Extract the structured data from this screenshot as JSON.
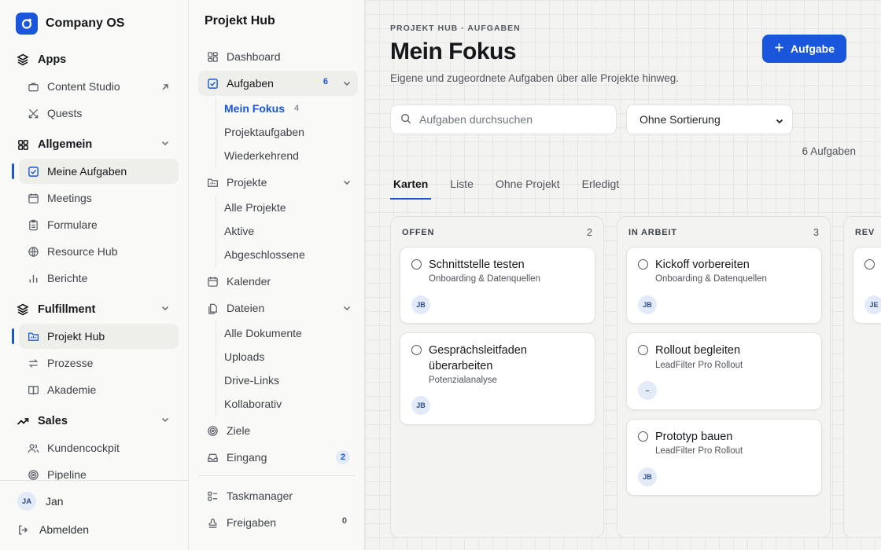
{
  "app": {
    "name": "Company OS"
  },
  "sidebar": {
    "sections": [
      {
        "label": "Apps",
        "icon": "apps-icon"
      },
      {
        "label": "Allgemein",
        "icon": "grid-icon"
      },
      {
        "label": "Fulfillment",
        "icon": "layers-icon"
      },
      {
        "label": "Sales",
        "icon": "trending-icon"
      }
    ],
    "items": [
      {
        "label": "Content Studio",
        "icon": "briefcase-icon"
      },
      {
        "label": "Quests",
        "icon": "swords-icon"
      },
      {
        "label": "Meine Aufgaben",
        "icon": "check-square-icon"
      },
      {
        "label": "Meetings",
        "icon": "calendar-icon"
      },
      {
        "label": "Formulare",
        "icon": "clipboard-icon"
      },
      {
        "label": "Resource Hub",
        "icon": "globe-icon"
      },
      {
        "label": "Berichte",
        "icon": "bar-chart-icon"
      },
      {
        "label": "Projekt Hub",
        "icon": "folder-icon"
      },
      {
        "label": "Prozesse",
        "icon": "arrows-icon"
      },
      {
        "label": "Akademie",
        "icon": "book-icon"
      },
      {
        "label": "Kundencockpit",
        "icon": "users-icon"
      },
      {
        "label": "Pipeline",
        "icon": "target-icon"
      }
    ],
    "user": {
      "initials": "JA",
      "name": "Jan"
    },
    "logout": "Abmelden"
  },
  "project_nav": {
    "title": "Projekt Hub",
    "items": [
      {
        "label": "Dashboard"
      },
      {
        "label": "Aufgaben",
        "badge": "6"
      },
      {
        "label": "Projekte"
      },
      {
        "label": "Kalender"
      },
      {
        "label": "Dateien"
      },
      {
        "label": "Ziele"
      },
      {
        "label": "Eingang",
        "badge": "2"
      },
      {
        "label": "Taskmanager"
      },
      {
        "label": "Freigaben",
        "badge": "0"
      }
    ],
    "aufgaben_sub": [
      {
        "label": "Mein Fokus",
        "count": "4"
      },
      {
        "label": "Projektaufgaben"
      },
      {
        "label": "Wiederkehrend"
      }
    ],
    "projekte_sub": [
      {
        "label": "Alle Projekte"
      },
      {
        "label": "Aktive"
      },
      {
        "label": "Abgeschlossene"
      }
    ],
    "dateien_sub": [
      {
        "label": "Alle Dokumente"
      },
      {
        "label": "Uploads"
      },
      {
        "label": "Drive-Links"
      },
      {
        "label": "Kollaborativ"
      }
    ]
  },
  "main": {
    "eyebrow": "PROJEKT HUB · AUFGABEN",
    "title": "Mein Fokus",
    "subtitle": "Eigene und zugeordnete Aufgaben über alle Projekte hinweg.",
    "add_button": "Aufgabe",
    "search_placeholder": "Aufgaben durchsuchen",
    "sort_value": "Ohne Sortierung",
    "task_count": "6 Aufgaben",
    "tabs": [
      "Karten",
      "Liste",
      "Ohne Projekt",
      "Erledigt"
    ],
    "columns": [
      {
        "title": "OFFEN",
        "count": "2",
        "cards": [
          {
            "title": "Schnittstelle testen",
            "project": "Onboarding & Datenquellen",
            "assignee": "JB"
          },
          {
            "title": "Gesprächsleitfaden überarbeiten",
            "project": "Potenzialanalyse",
            "assignee": "JB"
          }
        ]
      },
      {
        "title": "IN ARBEIT",
        "count": "3",
        "cards": [
          {
            "title": "Kickoff vorbereiten",
            "project": "Onboarding & Datenquellen",
            "assignee": "JB"
          },
          {
            "title": "Rollout begleiten",
            "project": "LeadFilter Pro Rollout",
            "assignee": "–"
          },
          {
            "title": "Prototyp bauen",
            "project": "LeadFilter Pro Rollout",
            "assignee": "JB"
          }
        ]
      },
      {
        "title": "REV",
        "count": "",
        "cards": [
          {
            "title": "",
            "project": "",
            "assignee": "JE"
          }
        ]
      }
    ]
  },
  "colors": {
    "accent": "#1a56db",
    "badge_bg": "#e4ebf8"
  }
}
